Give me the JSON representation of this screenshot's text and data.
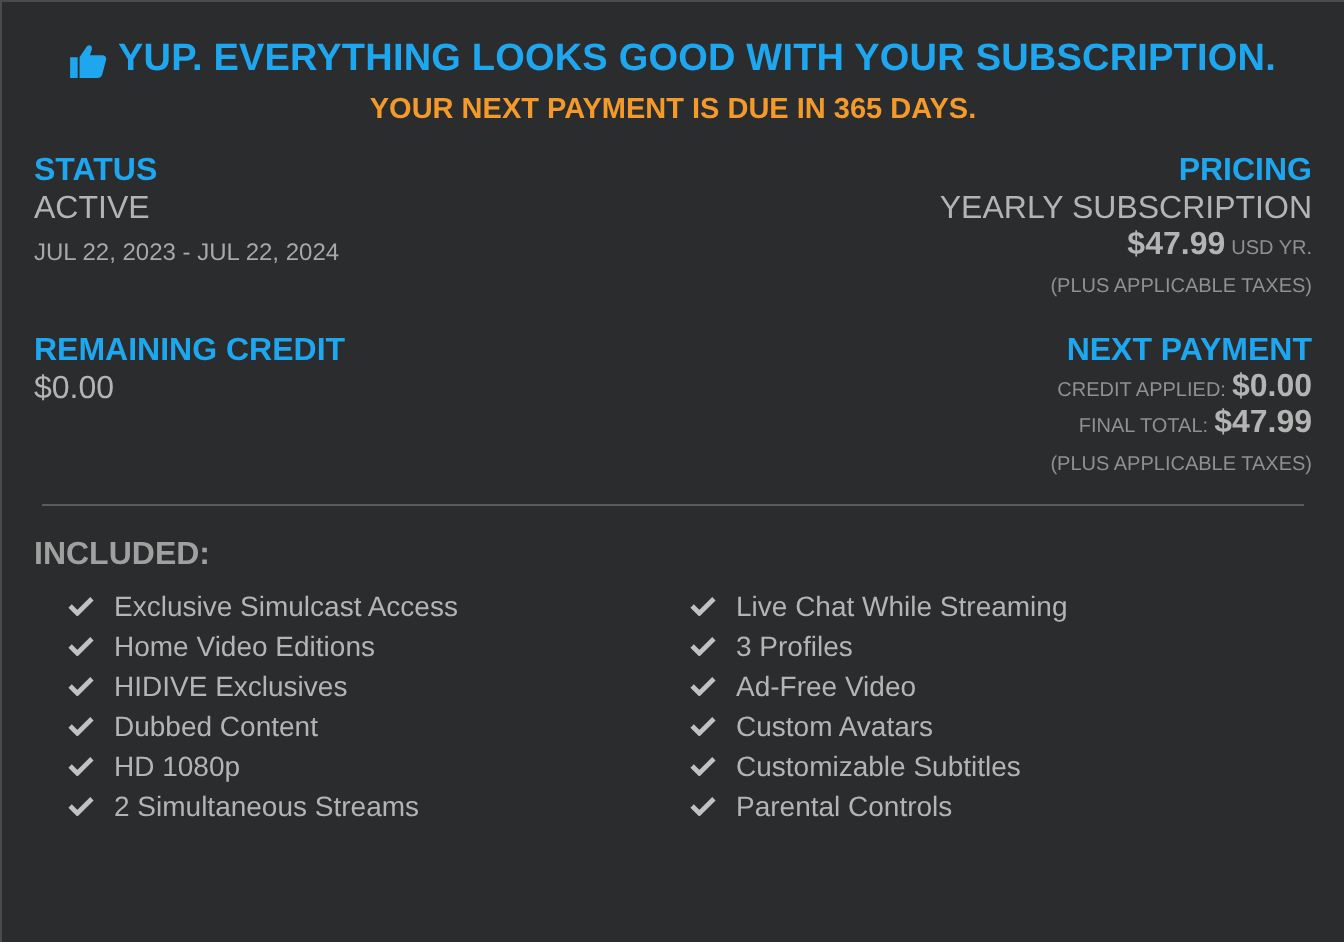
{
  "header": {
    "title": "YUP. EVERYTHING LOOKS GOOD WITH YOUR SUBSCRIPTION.",
    "subtitle": "YOUR NEXT PAYMENT IS DUE IN 365 DAYS."
  },
  "status": {
    "label": "STATUS",
    "value": "ACTIVE",
    "period": "JUL 22, 2023 - JUL 22, 2024"
  },
  "pricing": {
    "label": "PRICING",
    "plan": "YEARLY SUBSCRIPTION",
    "price": "$47.99",
    "unit": "USD YR.",
    "note": "(PLUS APPLICABLE TAXES)"
  },
  "remaining_credit": {
    "label": "REMAINING CREDIT",
    "value": "$0.00"
  },
  "next_payment": {
    "label": "NEXT PAYMENT",
    "lines": [
      {
        "label": "CREDIT APPLIED:",
        "value": "$0.00"
      },
      {
        "label": "FINAL TOTAL:",
        "value": "$47.99"
      }
    ],
    "note": "(PLUS APPLICABLE TAXES)"
  },
  "included": {
    "label": "INCLUDED:",
    "columns": [
      [
        "Exclusive Simulcast Access",
        "Home Video Editions",
        "HIDIVE Exclusives",
        "Dubbed Content",
        "HD 1080p",
        "2 Simultaneous Streams"
      ],
      [
        "Live Chat While Streaming",
        "3 Profiles",
        "Ad-Free Video",
        "Custom Avatars",
        "Customizable Subtitles",
        "Parental Controls"
      ]
    ]
  }
}
